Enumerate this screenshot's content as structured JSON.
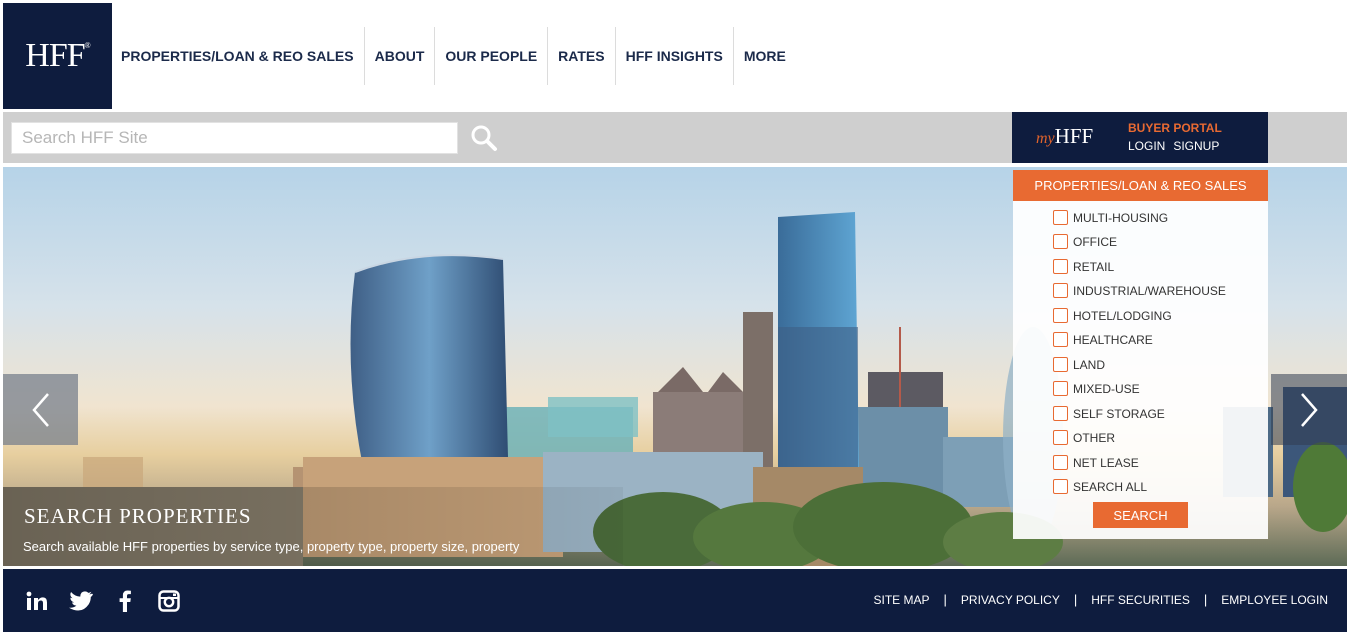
{
  "brand": {
    "logo_text": "HFF",
    "logo_mark": "®"
  },
  "nav": [
    {
      "label": "PROPERTIES/LOAN & REO SALES"
    },
    {
      "label": "ABOUT"
    },
    {
      "label": "OUR PEOPLE"
    },
    {
      "label": "RATES"
    },
    {
      "label": "HFF INSIGHTS"
    },
    {
      "label": "MORE"
    }
  ],
  "search": {
    "placeholder": "Search HFF Site",
    "icon": "search-icon"
  },
  "portal": {
    "logo_prefix": "my",
    "logo_text": "HFF",
    "title": "BUYER PORTAL",
    "login": "LOGIN",
    "signup": "SIGNUP"
  },
  "hero": {
    "title": "SEARCH PROPERTIES",
    "subtitle": "Search available HFF properties by service type, property type, property size, property"
  },
  "properties_panel": {
    "header": "PROPERTIES/LOAN & REO SALES",
    "options": [
      {
        "label": "MULTI-HOUSING"
      },
      {
        "label": "OFFICE"
      },
      {
        "label": "RETAIL"
      },
      {
        "label": "INDUSTRIAL/WAREHOUSE"
      },
      {
        "label": "HOTEL/LODGING"
      },
      {
        "label": "HEALTHCARE"
      },
      {
        "label": "LAND"
      },
      {
        "label": "MIXED-USE"
      },
      {
        "label": "SELF STORAGE"
      },
      {
        "label": "OTHER"
      },
      {
        "label": "NET LEASE"
      },
      {
        "label": "SEARCH ALL"
      }
    ],
    "button": "SEARCH"
  },
  "footer": {
    "social": [
      "linkedin-icon",
      "twitter-icon",
      "facebook-icon",
      "instagram-icon"
    ],
    "links": [
      {
        "label": "SITE MAP"
      },
      {
        "label": "PRIVACY POLICY"
      },
      {
        "label": "HFF SECURITIES"
      },
      {
        "label": "EMPLOYEE LOGIN"
      }
    ]
  },
  "colors": {
    "navy": "#0e1c3e",
    "orange": "#e86a32",
    "gray_bar": "#cfcfcf"
  }
}
